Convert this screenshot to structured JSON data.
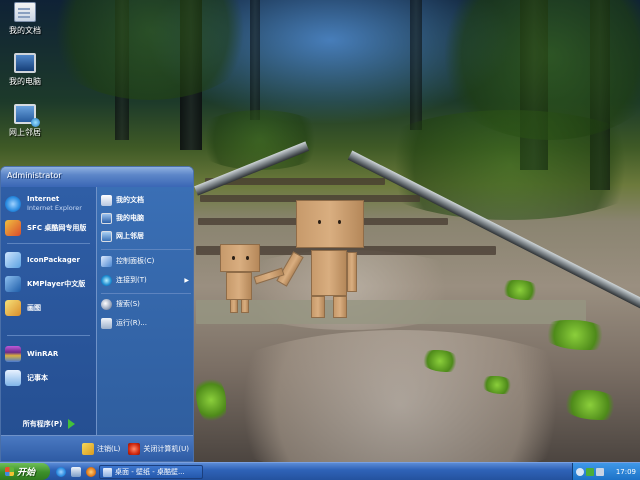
{
  "desktop": {
    "icons": [
      {
        "label": "我的文档",
        "icon": "my-documents-icon"
      },
      {
        "label": "我的电脑",
        "icon": "my-computer-icon"
      },
      {
        "label": "网上邻居",
        "icon": "network-places-icon"
      }
    ]
  },
  "start_menu": {
    "username": "Administrator",
    "pinned": [
      {
        "title": "Internet",
        "subtitle": "Internet Explorer",
        "icon": "internet-explorer-icon",
        "color": "#2a8be0"
      },
      {
        "title": "SFC 桌酷网专用版",
        "icon": "sfc-icon",
        "color": "#d94a2b"
      }
    ],
    "recent": [
      {
        "title": "IconPackager",
        "icon": "iconpackager-icon",
        "color": "#5aa0e0"
      },
      {
        "title": "KMPlayer中文版",
        "icon": "kmplayer-icon",
        "color": "#3a7fcf"
      },
      {
        "title": "画图",
        "icon": "paint-icon",
        "color": "#e0b040"
      },
      {
        "title": "WinRAR",
        "icon": "winrar-icon",
        "color": "#8e4aa8"
      },
      {
        "title": "记事本",
        "icon": "notepad-icon",
        "color": "#7fb4e8"
      }
    ],
    "all_programs": "所有程序(P)",
    "places": [
      {
        "title": "我的文档",
        "icon": "my-documents-icon",
        "color": "#f0f0f0"
      },
      {
        "title": "我的电脑",
        "icon": "my-computer-icon",
        "color": "#5a8fd0"
      },
      {
        "title": "网上邻居",
        "icon": "network-places-icon",
        "color": "#6aa2dd"
      }
    ],
    "system": [
      {
        "title": "控制面板(C)",
        "icon": "control-panel-icon",
        "color": "#7fb0e8"
      },
      {
        "title": "连接到(T)",
        "icon": "connect-to-icon",
        "color": "#3aa0d8",
        "has_submenu": true
      }
    ],
    "tools": [
      {
        "title": "搜索(S)",
        "icon": "search-icon",
        "color": "#e8e8f0"
      },
      {
        "title": "运行(R)...",
        "icon": "run-icon",
        "color": "#d8dde8"
      }
    ],
    "logoff": "注销(L)",
    "shutdown": "关闭计算机(U)"
  },
  "taskbar": {
    "start_label": "开始",
    "task_label": "桌面 - 壁纸 - 桌酷壁...",
    "clock": "17:09",
    "quicklaunch": [
      "ie-icon",
      "desktop-icon",
      "media-icon"
    ]
  }
}
